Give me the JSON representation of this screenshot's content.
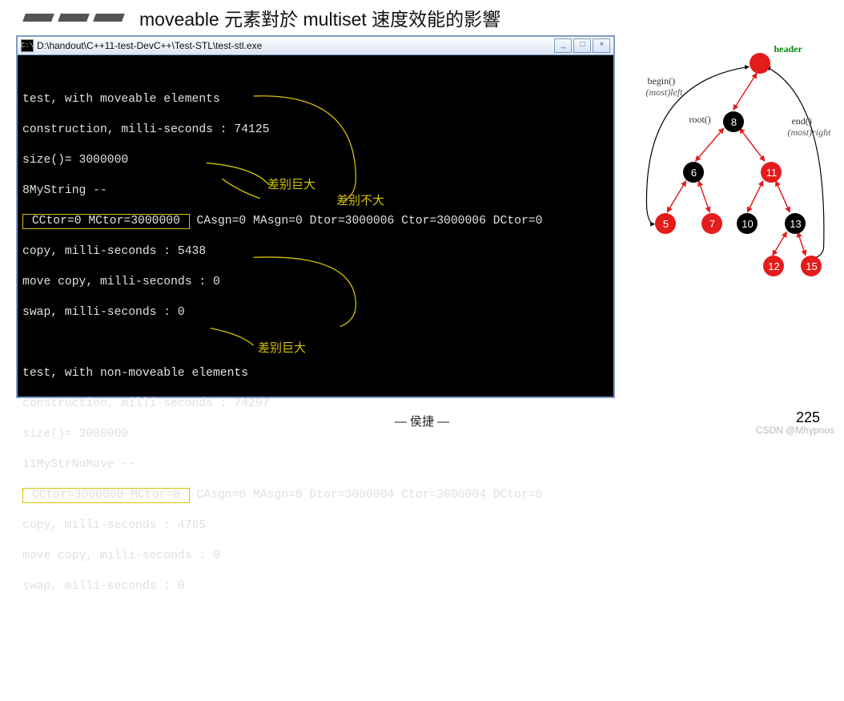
{
  "header": {
    "title": "moveable 元素對於 multiset 速度效能的影響"
  },
  "window": {
    "title_prefix": "C:\\",
    "title": "D:\\handout\\C++11-test-DevC++\\Test-STL\\test-stl.exe",
    "console_lines": {
      "l1": "",
      "l2": "test, with moveable elements",
      "l3": "construction, milli-seconds : 74125",
      "l4": "size()= 3000000",
      "l5": "8MyString --",
      "l6_box": " CCtor=0 MCtor=3000000 ",
      "l6_rest": " CAsgn=0 MAsgn=0 Dtor=3000006 Ctor=3000006 DCtor=0",
      "l7": "copy, milli-seconds : 5438",
      "l8": "move copy, milli-seconds : 0",
      "l9": "swap, milli-seconds : 0",
      "blank": "",
      "l10": "test, with non-moveable elements",
      "l11": "construction, milli-seconds : 74297",
      "l12": "size()= 3000000",
      "l13": "11MyStrNoMove --",
      "l14_box": " CCtor=3000000 MCtor=0 ",
      "l14_rest": " CAsgn=0 MAsgn=0 Dtor=3000004 Ctor=3000004 DCtor=0",
      "l15": "copy, milli-seconds : 4765",
      "l16": "move copy, milli-seconds : 0",
      "l17": "swap, milli-seconds : 0"
    },
    "annotations": {
      "label_big1": "差别巨大",
      "label_small": "差别不大",
      "label_big2": "差别巨大"
    }
  },
  "tree": {
    "header_label": "header",
    "begin_label": "begin()",
    "mostleft_label": "(most)left",
    "root_label": "root()",
    "end_label": "end()",
    "mostright_label": "(most)right",
    "nodes": {
      "n8": "8",
      "n6": "6",
      "n11": "11",
      "n5": "5",
      "n7": "7",
      "n10": "10",
      "n13": "13",
      "n12": "12",
      "n15": "15"
    }
  },
  "footer": {
    "author": "— 侯捷 —",
    "page": "225",
    "watermark": "CSDN @Mhypnos"
  }
}
